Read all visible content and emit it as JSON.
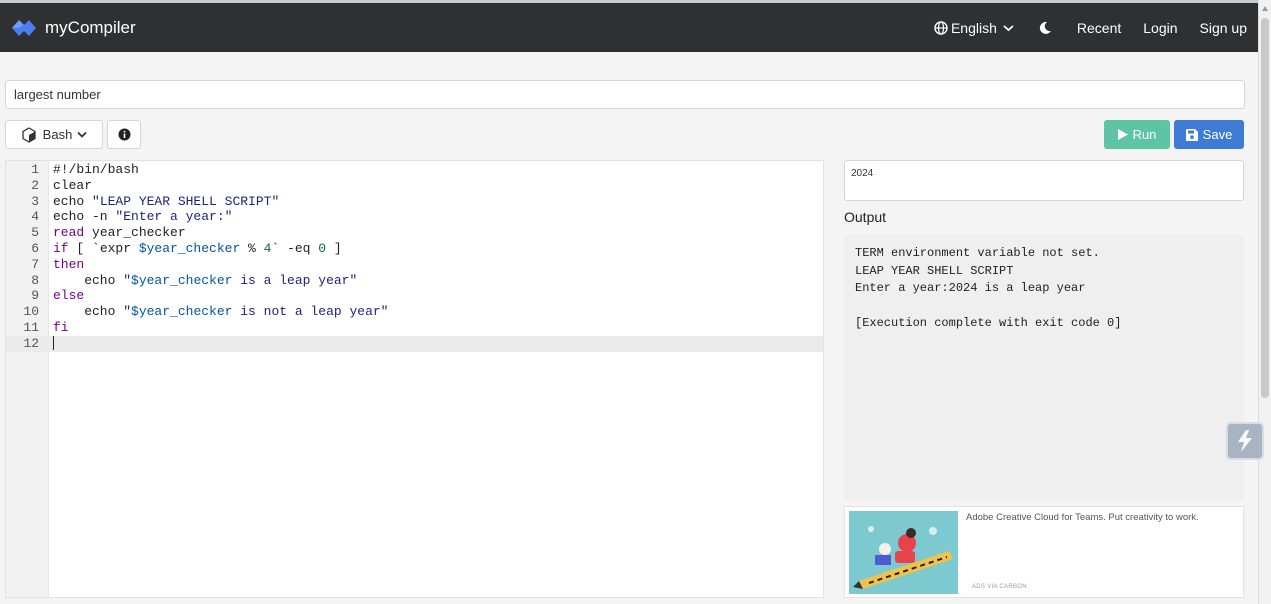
{
  "header": {
    "brand": "myCompiler",
    "language_menu": "English",
    "recent": "Recent",
    "login": "Login",
    "signup": "Sign up"
  },
  "program": {
    "title_value": "largest number"
  },
  "toolbar": {
    "language": "Bash",
    "run_label": "Run",
    "save_label": "Save"
  },
  "editor": {
    "lines": [
      "#!/bin/bash",
      "clear",
      "echo \"LEAP YEAR SHELL SCRIPT\"",
      "echo -n \"Enter a year:\"",
      "read year_checker",
      "if [ `expr $year_checker % 4` -eq 0 ]",
      "then",
      "    echo \"$year_checker is a leap year\"",
      "else",
      "    echo \"$year_checker is not a leap year\"",
      "fi",
      ""
    ],
    "line_numbers": [
      "1",
      "2",
      "3",
      "4",
      "5",
      "6",
      "7",
      "8",
      "9",
      "10",
      "11",
      "12"
    ]
  },
  "stdin": {
    "value": "2024"
  },
  "output": {
    "label": "Output",
    "lines": [
      "TERM environment variable not set.",
      "LEAP YEAR SHELL SCRIPT",
      "Enter a year:2024 is a leap year",
      "",
      "[Execution complete with exit code 0]"
    ]
  },
  "ad": {
    "text": "Adobe Creative Cloud for Teams. Put creativity to work.",
    "via": "ADS VIA CARBON"
  },
  "colors": {
    "topbar": "#2f3031",
    "run": "#5dc4a5",
    "save": "#3e7bd5",
    "logo": "#4a7ef0"
  },
  "icons": [
    "logo-icon",
    "globe-icon",
    "chevron-down-icon",
    "moon-icon",
    "bash-icon",
    "info-icon",
    "play-icon",
    "save-icon",
    "float-action-icon"
  ]
}
